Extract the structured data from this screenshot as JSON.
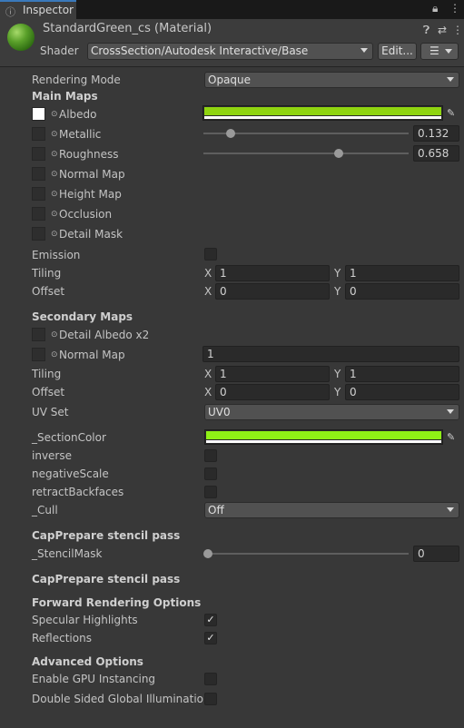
{
  "window": {
    "tab_icon": "info-icon",
    "tab_label": "Inspector",
    "lock_icon": "lock-icon",
    "more_icon": "kebab-menu-icon"
  },
  "header": {
    "title": "StandardGreen_cs (Material)",
    "shader_label": "Shader",
    "shader_value": "CrossSection/Autodesk Interactive/Base",
    "edit_label": "Edit...",
    "help_icon": "help-icon",
    "preset_icon": "preset-icon",
    "more_icon": "kebab-menu-icon"
  },
  "colors": {
    "albedo": "#8fd410",
    "section": "#8ff016",
    "accent": "#3a79bb"
  },
  "rendering_mode": {
    "label": "Rendering Mode",
    "value": "Opaque"
  },
  "main_maps": {
    "header": "Main Maps",
    "albedo": "Albedo",
    "metallic": {
      "label": "Metallic",
      "value": "0.132"
    },
    "roughness": {
      "label": "Roughness",
      "value": "0.658"
    },
    "normal_map": "Normal Map",
    "height_map": "Height Map",
    "occlusion": "Occlusion",
    "detail_mask": "Detail Mask"
  },
  "emission": {
    "label": "Emission",
    "checked": false
  },
  "tiling": {
    "label": "Tiling",
    "x": "1",
    "y": "1"
  },
  "offset": {
    "label": "Offset",
    "x": "0",
    "y": "0"
  },
  "secondary_maps": {
    "header": "Secondary Maps",
    "detail_albedo": "Detail Albedo x2",
    "normal_map": "Normal Map",
    "normal_scale": "1",
    "tiling": {
      "label": "Tiling",
      "x": "1",
      "y": "1"
    },
    "offset": {
      "label": "Offset",
      "x": "0",
      "y": "0"
    },
    "uv_set": {
      "label": "UV Set",
      "value": "UV0"
    }
  },
  "axis_x": "X",
  "axis_y": "Y",
  "section": {
    "color_label": "_SectionColor",
    "inverse": "inverse",
    "negative_scale": "negativeScale",
    "retract_backfaces": "retractBackfaces",
    "cull": {
      "label": "_Cull",
      "value": "Off"
    }
  },
  "stencil": {
    "header1": "CapPrepare stencil pass",
    "mask_label": "_StencilMask",
    "mask_value": "0",
    "header2": "CapPrepare stencil pass"
  },
  "forward": {
    "header": "Forward Rendering Options",
    "specular": {
      "label": "Specular Highlights",
      "checked": true
    },
    "reflections": {
      "label": "Reflections",
      "checked": true
    }
  },
  "advanced": {
    "header": "Advanced Options",
    "gpu_instancing": {
      "label": "Enable GPU Instancing",
      "checked": false
    },
    "double_sided_gi": {
      "label": "Double Sided Global Illumination",
      "checked": false
    }
  },
  "sliders": {
    "metallic": 0.132,
    "roughness": 0.658,
    "stencil_mask": 0
  }
}
